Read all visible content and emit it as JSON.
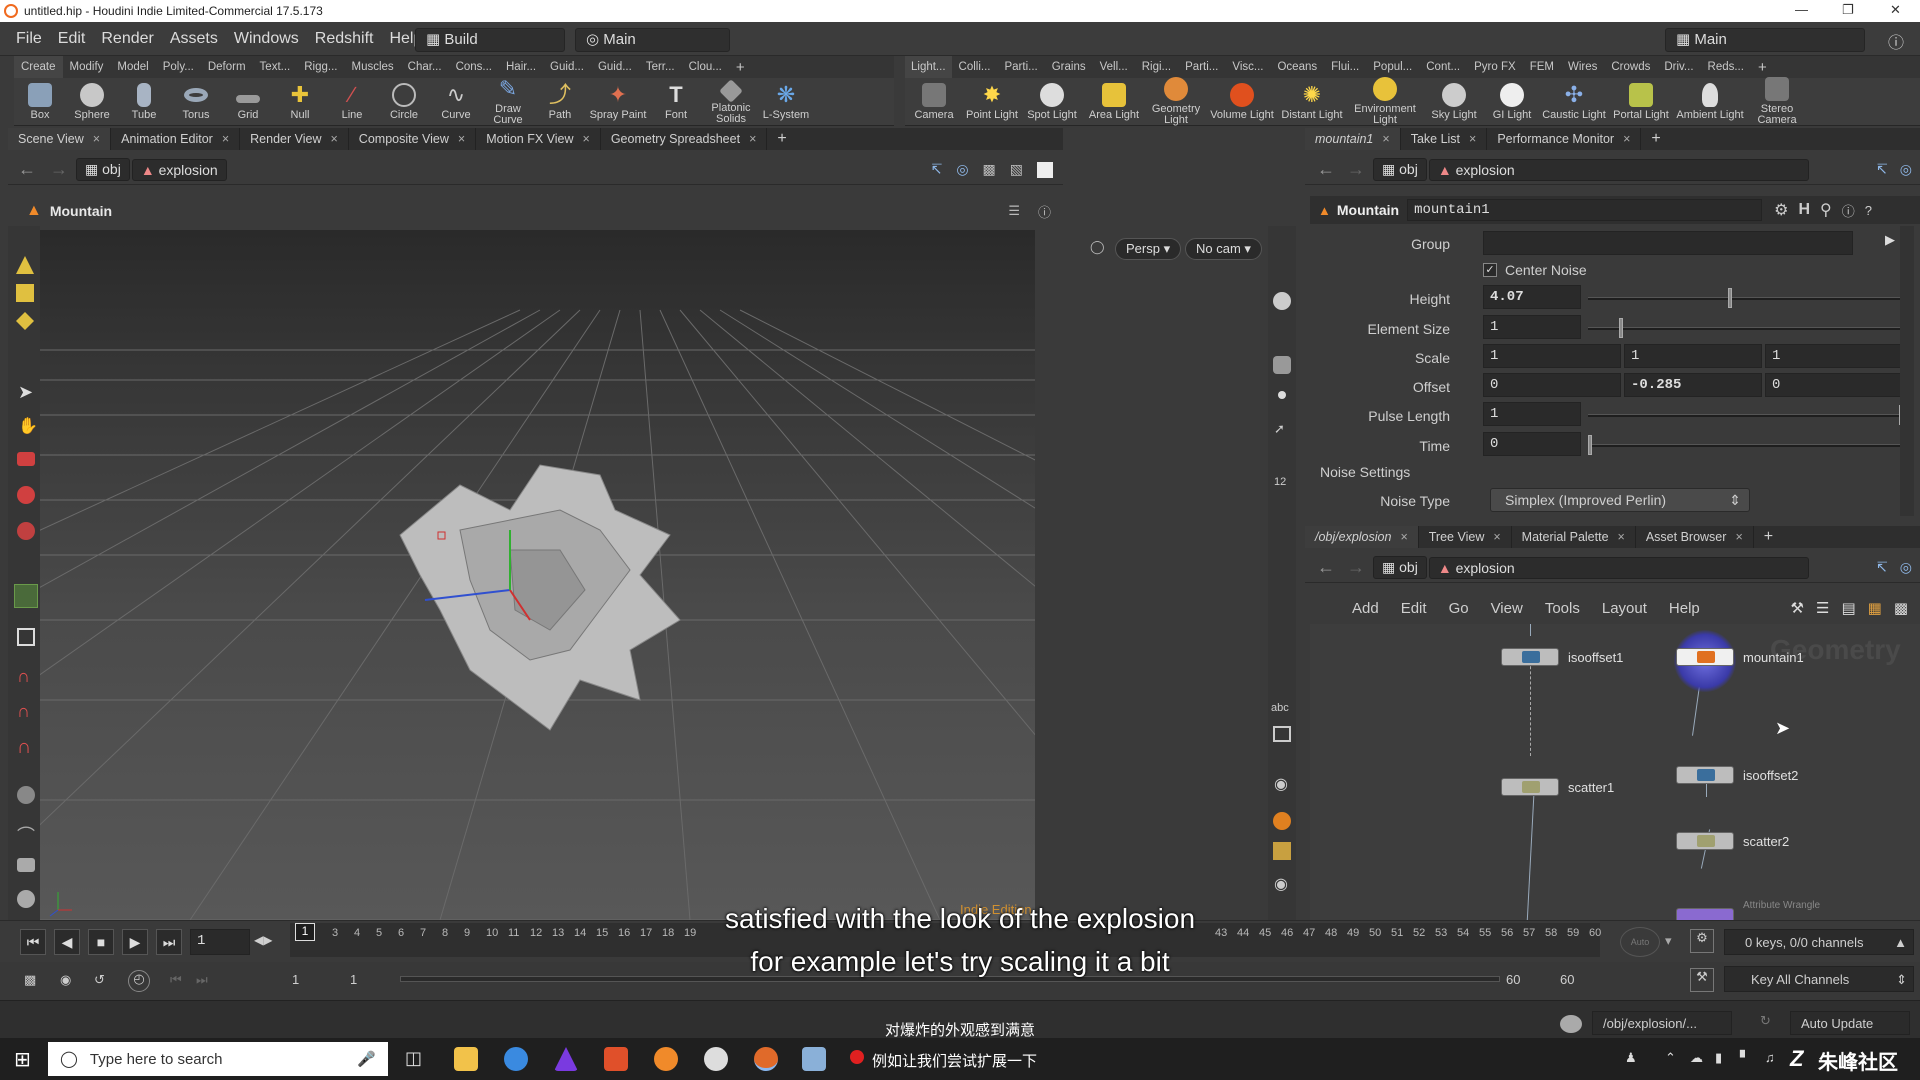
{
  "window": {
    "title": "untitled.hip - Houdini Indie Limited-Commercial 17.5.173"
  },
  "menubar": {
    "items": [
      "File",
      "Edit",
      "Render",
      "Assets",
      "Windows",
      "Redshift",
      "Help"
    ],
    "desktop_left": "Build",
    "desktop_right": "Main",
    "desktop_center": "Main"
  },
  "shelf_left": {
    "tabs": [
      "Create",
      "Modify",
      "Model",
      "Poly...",
      "Deform",
      "Text...",
      "Rigg...",
      "Muscles",
      "Char...",
      "Cons...",
      "Hair...",
      "Guid...",
      "Guid...",
      "Terr...",
      "Clou..."
    ],
    "tools": [
      "Box",
      "Sphere",
      "Tube",
      "Torus",
      "Grid",
      "Null",
      "Line",
      "Circle",
      "Curve",
      "Draw Curve",
      "Path",
      "Spray Paint",
      "Font",
      "Platonic Solids",
      "L-System"
    ]
  },
  "shelf_right": {
    "tabs": [
      "Light...",
      "Colli...",
      "Parti...",
      "Grains",
      "Vell...",
      "Rigi...",
      "Parti...",
      "Visc...",
      "Oceans",
      "Flui...",
      "Popul...",
      "Cont...",
      "Pyro FX",
      "FEM",
      "Wires",
      "Crowds",
      "Driv...",
      "Reds..."
    ],
    "tools": [
      "Camera",
      "Point Light",
      "Spot Light",
      "Area Light",
      "Geometry Light",
      "Volume Light",
      "Distant Light",
      "Environment Light",
      "Sky Light",
      "GI Light",
      "Caustic Light",
      "Portal Light",
      "Ambient Light",
      "Stereo Camera"
    ]
  },
  "left_pane": {
    "tabs": [
      "Scene View",
      "Animation Editor",
      "Render View",
      "Composite View",
      "Motion FX View",
      "Geometry Spreadsheet"
    ],
    "path": {
      "root": "obj",
      "node": "explosion"
    },
    "node_title": "Mountain",
    "view_persp": "Persp",
    "view_cam": "No cam",
    "watermark": "Indie Edition",
    "side_label": "abc"
  },
  "param_pane": {
    "tabs": [
      "mountain1",
      "Take List",
      "Performance Monitor"
    ],
    "path": {
      "root": "obj",
      "node": "explosion"
    },
    "node_type": "Mountain",
    "node_name": "mountain1",
    "params": {
      "group_label": "Group",
      "group_value": "",
      "center_noise_label": "Center Noise",
      "height_label": "Height",
      "height_value": "4.07",
      "element_size_label": "Element Size",
      "element_size_value": "1",
      "scale_label": "Scale",
      "scale_values": [
        "1",
        "1",
        "1"
      ],
      "offset_label": "Offset",
      "offset_values": [
        "0",
        "-0.285",
        "0"
      ],
      "pulse_length_label": "Pulse Length",
      "pulse_length_value": "1",
      "time_label": "Time",
      "time_value": "0",
      "noise_settings_label": "Noise Settings",
      "noise_type_label": "Noise Type",
      "noise_type_value": "Simplex (Improved Perlin)"
    },
    "sliders": {
      "height": 0.45,
      "element_size": 0.1,
      "pulse_length": 1.0,
      "time": 0.0
    }
  },
  "network_pane": {
    "tabs": [
      "/obj/explosion",
      "Tree View",
      "Material Palette",
      "Asset Browser"
    ],
    "path": {
      "root": "obj",
      "node": "explosion"
    },
    "menu": [
      "Add",
      "Edit",
      "Go",
      "View",
      "Tools",
      "Layout",
      "Help"
    ],
    "watermark": "Geometry",
    "nodes": [
      "isooffset1",
      "mountain1",
      "scatter1",
      "isooffset2",
      "scatter2"
    ],
    "partial_node": "Attribute Wrangle"
  },
  "timeline": {
    "current_frame": "1",
    "frame_field": "1",
    "ticks_left": [
      "1",
      "3",
      "4",
      "5",
      "6",
      "7",
      "8",
      "9",
      "10",
      "11",
      "12",
      "13",
      "14",
      "15",
      "16",
      "17",
      "18",
      "19"
    ],
    "ticks_right": [
      "43",
      "44",
      "45",
      "46",
      "47",
      "48",
      "49",
      "50",
      "51",
      "52",
      "53",
      "54",
      "55",
      "56",
      "57",
      "58",
      "59",
      "60"
    ],
    "range_start": "1",
    "range_start2": "1",
    "range_end": "60",
    "range_end2": "60",
    "keys_info": "0 keys, 0/0 channels",
    "key_all_label": "Key All Channels",
    "auto_label": "Auto"
  },
  "subtitles": {
    "line1": "satisfied with the look of the explosion",
    "line2": "for example let's try scaling it a bit",
    "cn1": "对爆炸的外观感到满意",
    "cn2": "例如让我们尝试扩展一下"
  },
  "statusbar": {
    "path": "/obj/explosion/...",
    "auto_update": "Auto Update"
  },
  "taskbar": {
    "search_placeholder": "Type here to search",
    "brand": "朱峰社区"
  }
}
